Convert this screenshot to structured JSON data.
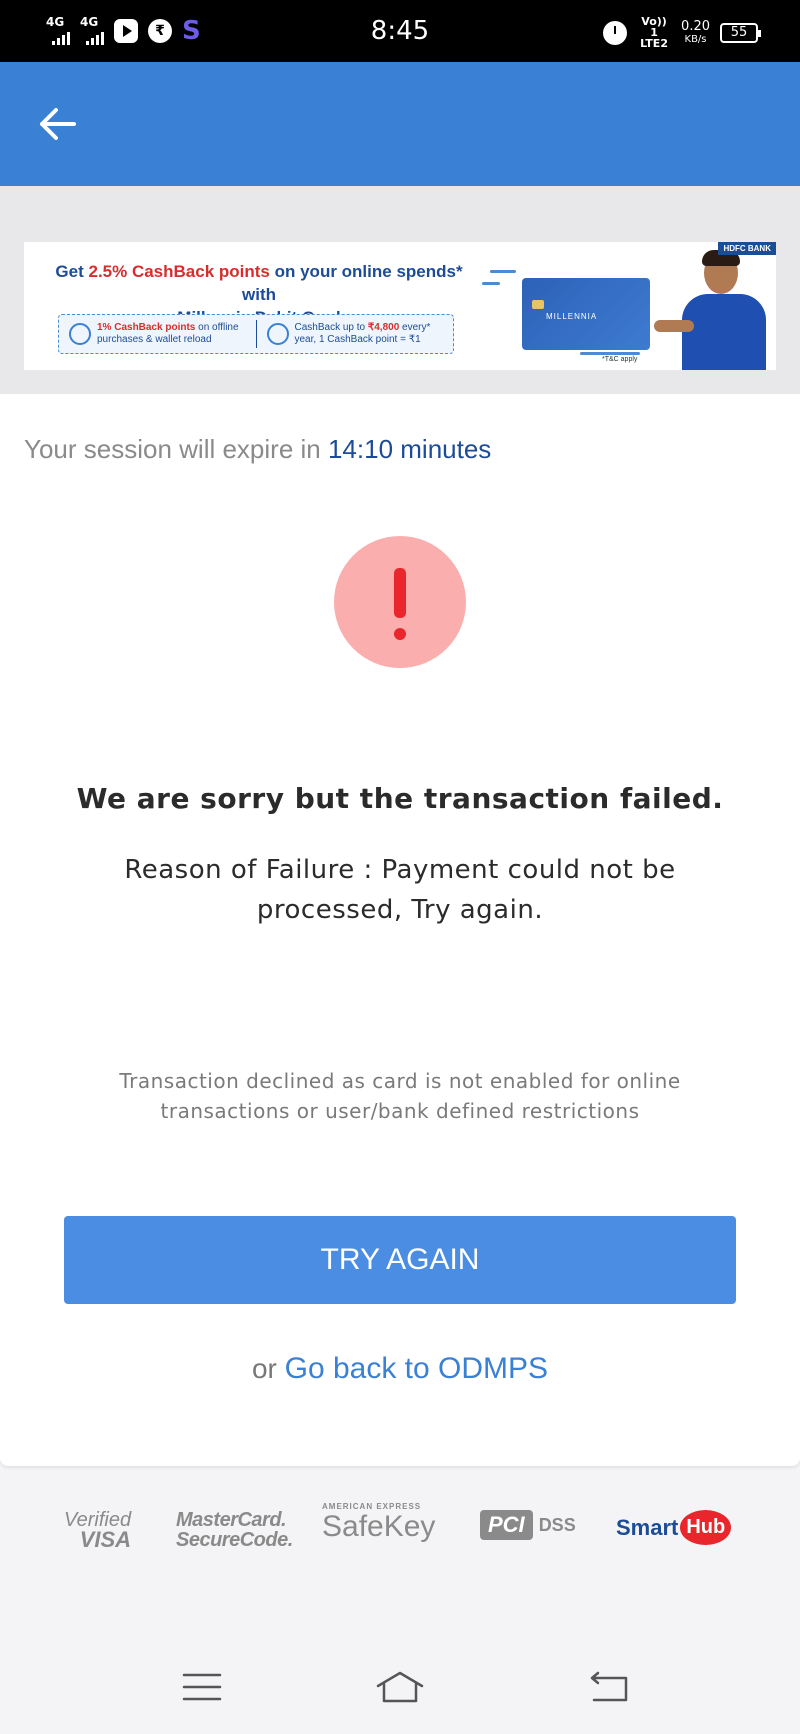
{
  "status_bar": {
    "time": "8:45",
    "network_1": "4G",
    "network_2": "4G",
    "volte": "Vo)) 1 LTE2",
    "speed_value": "0.20",
    "speed_unit": "KB/s",
    "battery": "55",
    "app_icons": [
      "youtube-icon",
      "phonepe-icon",
      "s-app-icon"
    ]
  },
  "header": {
    "back_icon": "arrow-left-icon",
    "color": "#3a80d4"
  },
  "banner": {
    "headline_prefix": "Get ",
    "headline_highlight": "2.5% CashBack points",
    "headline_suffix": " on your online spends* with",
    "headline_line2": "Millennia Debit Card",
    "offer_1_bold": "1% CashBack points",
    "offer_1_text": " on offline purchases & wallet reload",
    "offer_2_text": "CashBack up to ",
    "offer_2_bold": "₹4,800",
    "offer_2_tail": " every* year, 1 CashBack point = ₹1",
    "card_label": "MILLENNIA",
    "bank_badge": "HDFC BANK",
    "tnc": "*T&C apply"
  },
  "session": {
    "prefix": "Your session will expire in ",
    "timer": "14:10 minutes"
  },
  "result": {
    "status": "failure",
    "icon": "exclamation-icon",
    "title": "We are sorry but the transaction failed.",
    "reason": "Reason of Failure : Payment could not be processed, Try again.",
    "declined_note": "Transaction declined as card is not enabled for online transactions or user/bank defined restrictions"
  },
  "actions": {
    "try_again_label": "TRY AGAIN",
    "or_text": "or ",
    "go_back_label": "Go back to ODMPS"
  },
  "security_logos": {
    "visa_line1": "Verified",
    "visa_line2": "VISA",
    "mc_line1": "MasterCard.",
    "mc_line2": "SecureCode.",
    "amex_top": "AMERICAN EXPRESS",
    "amex_main": "SafeKey",
    "pci": "PCI",
    "dss": "DSS",
    "smarthub_a": "Smart",
    "smarthub_b": "Hub"
  },
  "nav_bar": {
    "icons": [
      "menu-icon",
      "home-icon",
      "back-icon"
    ]
  }
}
